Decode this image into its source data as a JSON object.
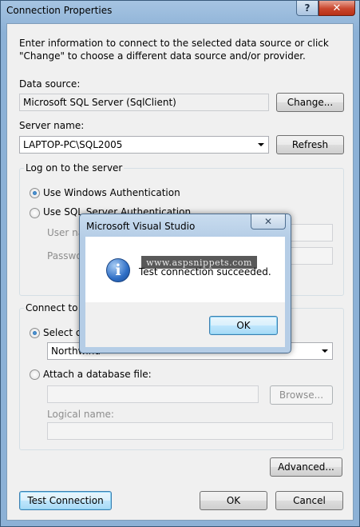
{
  "window": {
    "title": "Connection Properties",
    "help_glyph": "?",
    "close_glyph": "✕"
  },
  "intro_text": "Enter information to connect to the selected data source or click \"Change\" to choose a different data source and/or provider.",
  "data_source": {
    "label": "Data source:",
    "value": "Microsoft SQL Server (SqlClient)",
    "change_button": "Change..."
  },
  "server": {
    "label": "Server name:",
    "value": "LAPTOP-PC\\SQL2005",
    "refresh_button": "Refresh"
  },
  "logon": {
    "group_title": "Log on to the server",
    "windows_auth": "Use Windows Authentication",
    "sql_auth": "Use SQL Server Authentication",
    "user_name_label": "User na",
    "password_label": "Passwo"
  },
  "connect": {
    "group_title": "Connect to a",
    "select_label": "Select or",
    "database_value": "Northwind",
    "attach_label": "Attach a database file:",
    "browse_button": "Browse...",
    "logical_name_label": "Logical name:"
  },
  "buttons": {
    "advanced": "Advanced...",
    "test_connection": "Test Connection",
    "ok": "OK",
    "cancel": "Cancel"
  },
  "message_box": {
    "title": "Microsoft Visual Studio",
    "close_glyph": "✕",
    "message": "Test connection succeeded.",
    "ok_button": "OK",
    "icon": "info-icon",
    "watermark": "www.aspsnippets.com"
  }
}
